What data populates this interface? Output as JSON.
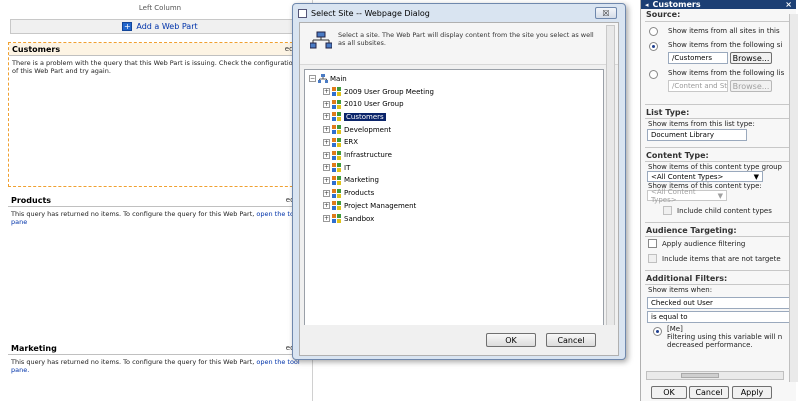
{
  "zone": {
    "title": "Left Column",
    "add_label": "Add a Web Part"
  },
  "webparts": {
    "customers": {
      "title": "Customers",
      "edit": "edit",
      "message": "There is a problem with the query that this Web Part is issuing. Check the configuration of this Web Part and try again."
    },
    "products": {
      "title": "Products",
      "edit": "edit",
      "message": "This query has returned no items. To configure the query for this Web Part, ",
      "link": "open the tool pane"
    },
    "marketing": {
      "title": "Marketing",
      "edit": "edit",
      "message": "This query has returned no items. To configure the query for this Web Part, ",
      "link": "open the tool pane."
    }
  },
  "dialog": {
    "title": "Select Site -- Webpage Dialog",
    "close": "☒",
    "description": "Select a site. The Web Part will display content from the site you select as well as all subsites.",
    "tree": {
      "root": "Main",
      "children": [
        "2009 User Group Meeting",
        "2010 User Group",
        "Customers",
        "Development",
        "ERX",
        "Infrastructure",
        "IT",
        "Marketing",
        "Products",
        "Project Management",
        "Sandbox"
      ],
      "selected": "Customers"
    },
    "ok": "OK",
    "cancel": "Cancel"
  },
  "toolpane": {
    "title": "Customers",
    "close": "×",
    "source": {
      "heading": "Source:",
      "opt_all": "Show items from all sites in this",
      "opt_site": "Show items from the following si",
      "site_value": "/Customers",
      "browse": "Browse...",
      "opt_list": "Show items from the following lis",
      "list_value": "/Content and St",
      "browse2": "Browse..."
    },
    "list_type": {
      "heading": "List Type:",
      "label": "Show items from this list type:",
      "value": "Document Library"
    },
    "content_type": {
      "heading": "Content Type:",
      "group_label": "Show items of this content type group",
      "group_value": "<All Content Types>",
      "type_label": "Show items of this content type:",
      "type_value": "<All Content Types>",
      "include_child": "Include child content types"
    },
    "audience": {
      "heading": "Audience Targeting:",
      "apply": "Apply audience filtering",
      "include_not": "Include items that are not targete"
    },
    "filters": {
      "heading": "Additional Filters:",
      "label": "Show items when:",
      "field_value": "Checked out User",
      "operator": "is equal to",
      "me": "[Me]",
      "note": "Filtering using this variable will n decreased performance."
    },
    "buttons": {
      "ok": "OK",
      "cancel": "Cancel",
      "apply": "Apply"
    }
  },
  "colors": {
    "pane_title_bg": "#1c3f74",
    "selection_bg": "#0a246a",
    "dialog_frame": "#d9e4f1"
  }
}
